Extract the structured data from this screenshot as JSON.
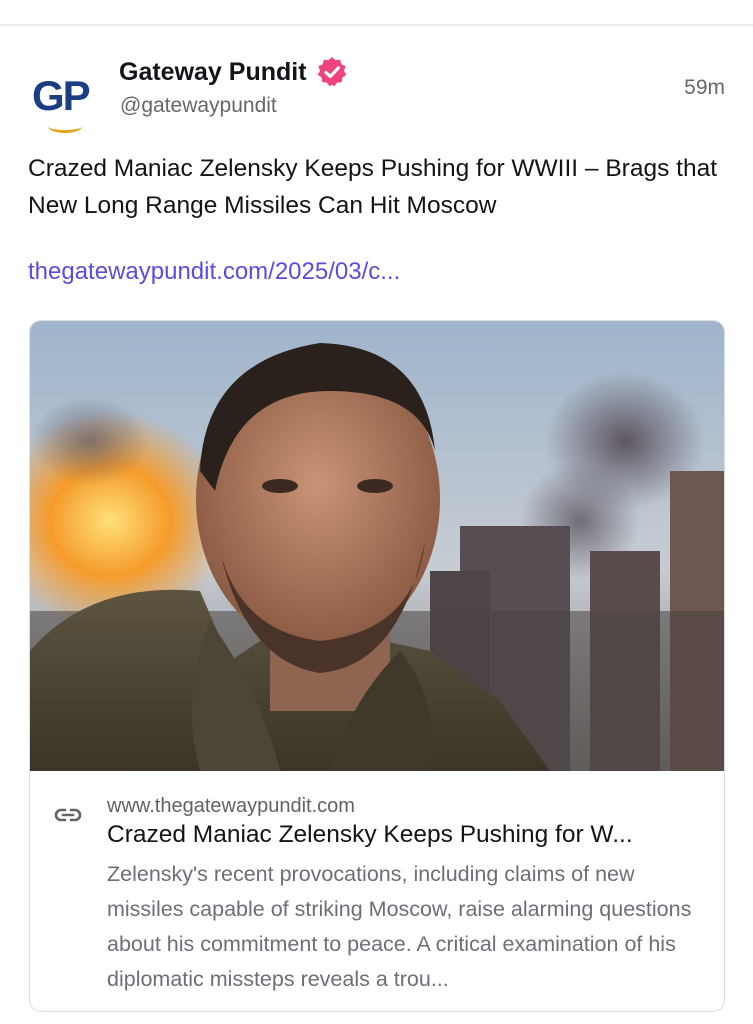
{
  "author": {
    "logo_text": "GP",
    "display_name": "Gateway Pundit",
    "handle": "@gatewaypundit",
    "verified_icon": "verified-badge-icon",
    "verified_color": "#f0427c"
  },
  "timestamp": "59m",
  "post": {
    "text": "Crazed Maniac Zelensky Keeps Pushing for WWIII – Brags that New Long Range Missiles Can Hit Moscow",
    "link": "thegatewaypundit.com/2025/03/c...",
    "link_color": "#5b4ce0"
  },
  "link_card": {
    "image_icon": "article-photo",
    "link_icon": "link-icon",
    "domain": "www.thegatewaypundit.com",
    "title": "Crazed Maniac Zelensky Keeps Pushing for W...",
    "description": "Zelensky's recent provocations, including claims of new missiles capable of striking Moscow, raise alarming questions about his commitment to peace. A critical examination of his diplomatic missteps reveals a trou..."
  }
}
